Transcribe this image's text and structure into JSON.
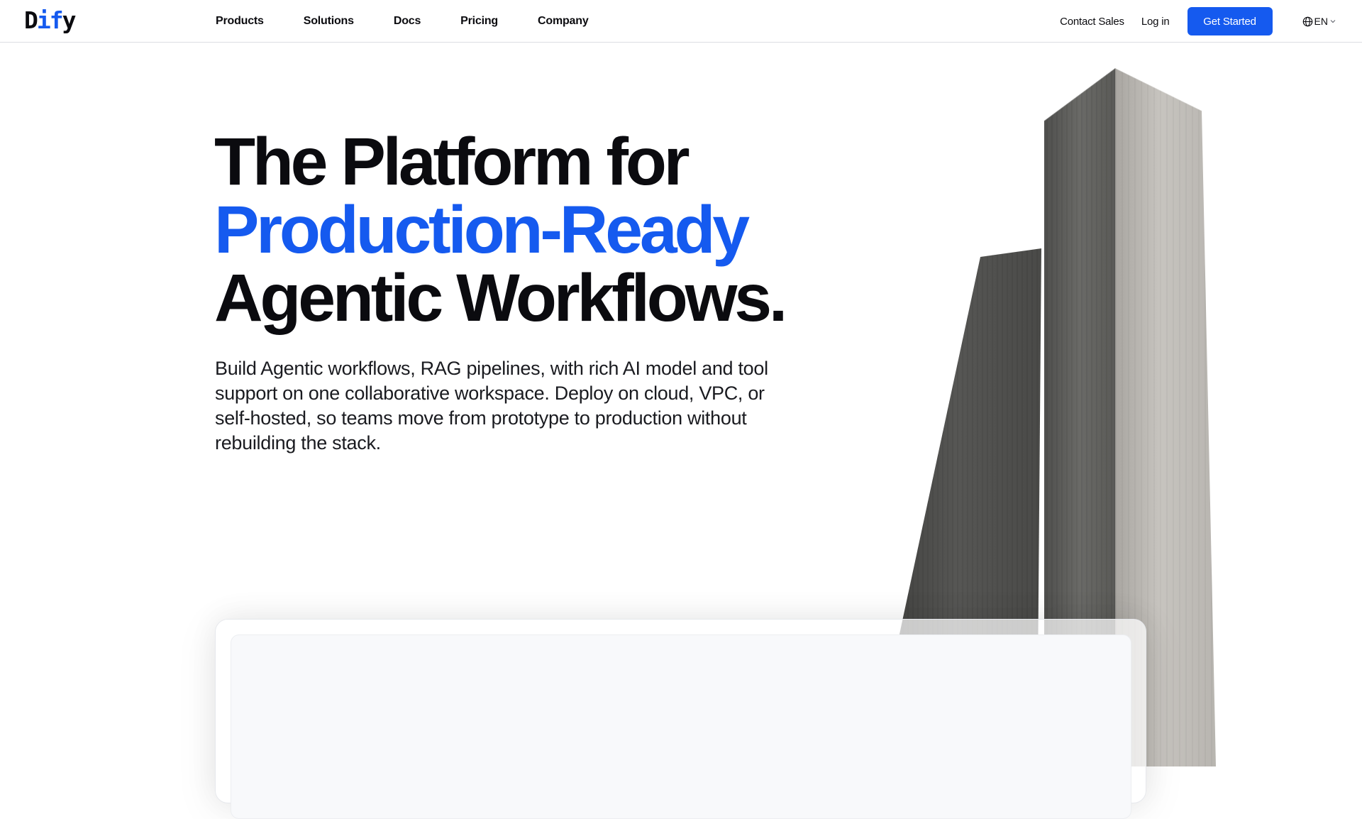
{
  "nav": {
    "logo": {
      "part1": "D",
      "part2": "if",
      "part3": "y"
    },
    "links": [
      "Products",
      "Solutions",
      "Docs",
      "Pricing",
      "Company"
    ],
    "contact_sales": "Contact Sales",
    "login": "Log in",
    "get_started": "Get Started",
    "language": "EN"
  },
  "hero": {
    "title_line1": "The Platform for",
    "title_line2": "Production-Ready",
    "title_line3": "Agentic Workflows.",
    "description": "Build Agentic workflows, RAG pipelines, with rich AI model and tool support on one collaborative workspace. Deploy on cloud, VPC, or self-hosted, so teams move from prototype to production without rebuilding the stack."
  },
  "colors": {
    "accent": "#155aef",
    "text": "#0b0b0f",
    "border": "#dcdee3"
  },
  "icons": {
    "language": "globe-icon",
    "language_dropdown": "chevron-down-icon"
  }
}
